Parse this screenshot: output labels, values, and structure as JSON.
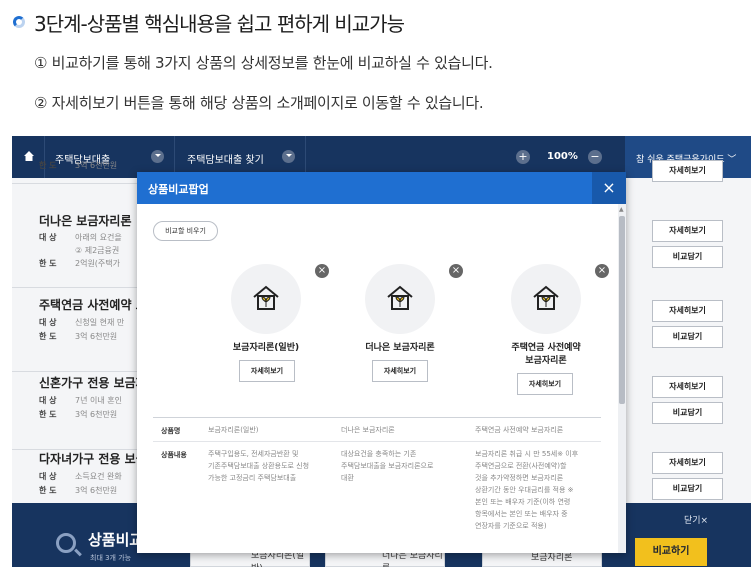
{
  "guide": {
    "title": "3단계-상품별 핵심내용을 쉽고 편하게 비교가능",
    "note1": "① 비교하기를 통해 3가지 상품의 상세정보를 한눈에 비교하실 수 있습니다.",
    "note2": "② 자세히보기 버튼을 통해 해당 상품의 소개페이지로 이동할 수 있습니다."
  },
  "topbar": {
    "menu1": "주택담보대출",
    "menu2": "주택담보대출 찾기",
    "zoom": "100%",
    "guide_link": "참 쉬운 주택금융가이드"
  },
  "list": [
    {
      "name": "",
      "rows": [
        {
          "k": "한 도",
          "v": "3억 6천만원"
        }
      ]
    },
    {
      "name": "더나은 보금자리론",
      "rows": [
        {
          "k": "대 상",
          "v": "아래의 요건을"
        },
        {
          "k": "",
          "v": "② 제2금융권"
        },
        {
          "k": "한 도",
          "v": "2억원(주택가"
        }
      ]
    },
    {
      "name": "주택연금 사전예약 보",
      "rows": [
        {
          "k": "대 상",
          "v": "신청일 현재 만"
        },
        {
          "k": "한 도",
          "v": "3억 6천만원"
        }
      ]
    },
    {
      "name": "신혼가구 전용 보금자",
      "rows": [
        {
          "k": "대 상",
          "v": "7년 이내 혼인"
        },
        {
          "k": "한 도",
          "v": "3억 6천만원"
        }
      ]
    },
    {
      "name": "다자녀가구 전용 보금",
      "rows": [
        {
          "k": "대 상",
          "v": "소득요건 완화"
        },
        {
          "k": "한 도",
          "v": "3억 6천만원"
        }
      ]
    }
  ],
  "right_buttons": {
    "detail": "자세히보기",
    "compare": "비교담기"
  },
  "bottom": {
    "title": "상품비교",
    "sub": "최대 3개 가능",
    "close": "닫기×",
    "compare": "비교하기",
    "slots": [
      "보금자리론(일반)",
      "더나은 보금자리론",
      "보금자리론"
    ]
  },
  "modal": {
    "title": "상품비교팝업",
    "close": "×",
    "clear": "비교할 비우기",
    "products": [
      {
        "name": "보금자리론(일반)",
        "button": "자세히보기"
      },
      {
        "name": "더나은 보금자리론",
        "button": "자세히보기"
      },
      {
        "name": "주택연금 사전예약\n보금자리론",
        "button": "자세히보기"
      }
    ],
    "table": {
      "row1_header": "상품명",
      "row1": [
        "보금자리론(일반)",
        "더나은 보금자리론",
        "주택연금 사전예약 보금자리론"
      ],
      "row2_header": "상품내용",
      "row2": [
        "주택구입용도, 전세자금반환 및\n기존주택담보대출 상환용도로 신청\n가능한 고정금리 주택담보대출",
        "대상요건을 충족하는 기존\n주택담보대출을 보금자리론으로\n대환",
        "보금자리론 취급 시 만 55세※ 이후\n주택연금으로 전환(사전예약)할\n것을 추가약정하면 보금자리론\n상환기간 동안 우대금리를 적용 ※\n본인 또는 배우자 기준(이하 연령\n항목에서는 본인 또는 배우자 중\n연장자를 기준으로 적용)"
      ]
    }
  }
}
